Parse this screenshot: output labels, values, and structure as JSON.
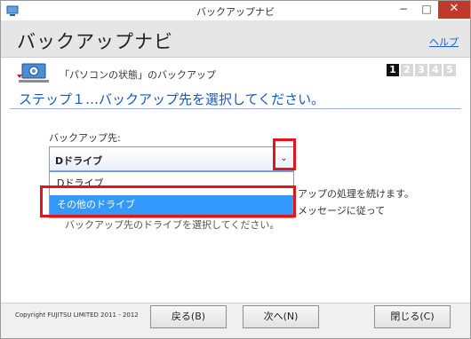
{
  "window": {
    "title": "バックアップナビ",
    "min_glyph": "−",
    "max_glyph": "□",
    "close_glyph": "✕"
  },
  "header": {
    "app_title": "バックアップナビ",
    "help_link": "ヘルプ"
  },
  "section": {
    "caption": "「パソコンの状態」のバックアップ",
    "steps": [
      "1",
      "2",
      "3",
      "4",
      "5"
    ],
    "active_step": 1
  },
  "heading": "ステップ１…バックアップ先を選択してください。",
  "destination": {
    "label": "バックアップ先:",
    "selected": "Dドライブ",
    "arrow_glyph": "⌄",
    "options": [
      "Dドライブ",
      "その他のドライブ"
    ],
    "highlighted_option": "その他のドライブ"
  },
  "description": {
    "line1_tail": "アップの処理を続けます。",
    "line2_tail": "メッセージに従って",
    "line3": "バックアップ先のドライブを選択してください。"
  },
  "footer": {
    "copyright": "Copyright FUJITSU LIMITED 2011 - 2012",
    "back_label": "戻る(B)",
    "next_label": "次へ(N)",
    "close_label": "閉じる(C)"
  },
  "colors": {
    "accent": "#1a55c9",
    "highlight_border": "#e2141c",
    "selected_option": "#3399ff"
  },
  "icons": [
    "app-icon",
    "pc-gear-icon",
    "chevron-down-icon"
  ]
}
